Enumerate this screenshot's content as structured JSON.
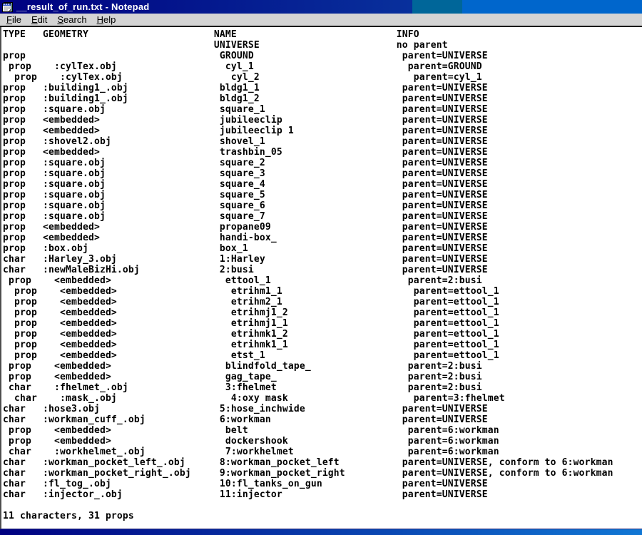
{
  "window": {
    "title": "__result_of_run.txt - Notepad"
  },
  "icons": {
    "app": "notepad-icon"
  },
  "colors": {
    "titlebar_gradient_start": "#000080",
    "titlebar_gradient_end": "#08309c",
    "desktop_gap": "#006699",
    "background_window_blue": "#0066cc",
    "menubar_gray": "#d4d4d4",
    "text": "#000000",
    "paper": "#ffffff"
  },
  "menu": {
    "items": [
      "File",
      "Edit",
      "Search",
      "Help"
    ]
  },
  "document": {
    "header": {
      "d": 0,
      "type": "TYPE",
      "geometry": "GEOMETRY",
      "name": "NAME",
      "info": "INFO"
    },
    "rows": [
      {
        "d": 0,
        "type": "",
        "geometry": "",
        "name": "UNIVERSE",
        "info": "no parent"
      },
      {
        "d": 1,
        "type": "prop",
        "geometry": "",
        "name": "GROUND",
        "info": "parent=UNIVERSE"
      },
      {
        "d": 2,
        "type": "prop",
        "geometry": ":cylTex.obj",
        "name": "cyl_1",
        "info": "parent=GROUND"
      },
      {
        "d": 3,
        "type": "prop",
        "geometry": ":cylTex.obj",
        "name": "cyl_2",
        "info": "parent=cyl_1"
      },
      {
        "d": 1,
        "type": "prop",
        "geometry": ":building1_.obj",
        "name": "bldg1_1",
        "info": "parent=UNIVERSE"
      },
      {
        "d": 1,
        "type": "prop",
        "geometry": ":building1_.obj",
        "name": "bldg1_2",
        "info": "parent=UNIVERSE"
      },
      {
        "d": 1,
        "type": "prop",
        "geometry": ":square.obj",
        "name": "square_1",
        "info": "parent=UNIVERSE"
      },
      {
        "d": 1,
        "type": "prop",
        "geometry": "<embedded>",
        "name": "jubileeclip",
        "info": "parent=UNIVERSE"
      },
      {
        "d": 1,
        "type": "prop",
        "geometry": "<embedded>",
        "name": "jubileeclip 1",
        "info": "parent=UNIVERSE"
      },
      {
        "d": 1,
        "type": "prop",
        "geometry": ":shovel2.obj",
        "name": "shovel_1",
        "info": "parent=UNIVERSE"
      },
      {
        "d": 1,
        "type": "prop",
        "geometry": "<embedded>",
        "name": "trashbin_05",
        "info": "parent=UNIVERSE"
      },
      {
        "d": 1,
        "type": "prop",
        "geometry": ":square.obj",
        "name": "square_2",
        "info": "parent=UNIVERSE"
      },
      {
        "d": 1,
        "type": "prop",
        "geometry": ":square.obj",
        "name": "square_3",
        "info": "parent=UNIVERSE"
      },
      {
        "d": 1,
        "type": "prop",
        "geometry": ":square.obj",
        "name": "square_4",
        "info": "parent=UNIVERSE"
      },
      {
        "d": 1,
        "type": "prop",
        "geometry": ":square.obj",
        "name": "square_5",
        "info": "parent=UNIVERSE"
      },
      {
        "d": 1,
        "type": "prop",
        "geometry": ":square.obj",
        "name": "square_6",
        "info": "parent=UNIVERSE"
      },
      {
        "d": 1,
        "type": "prop",
        "geometry": ":square.obj",
        "name": "square_7",
        "info": "parent=UNIVERSE"
      },
      {
        "d": 1,
        "type": "prop",
        "geometry": "<embedded>",
        "name": "propane09",
        "info": "parent=UNIVERSE"
      },
      {
        "d": 1,
        "type": "prop",
        "geometry": "<embedded>",
        "name": "handi-box_",
        "info": "parent=UNIVERSE"
      },
      {
        "d": 1,
        "type": "prop",
        "geometry": ":box.obj",
        "name": "box_1",
        "info": "parent=UNIVERSE"
      },
      {
        "d": 1,
        "type": "char",
        "geometry": ":Harley_3.obj",
        "name": "1:Harley",
        "info": "parent=UNIVERSE"
      },
      {
        "d": 1,
        "type": "char",
        "geometry": ":newMaleBizHi.obj",
        "name": "2:busi",
        "info": "parent=UNIVERSE"
      },
      {
        "d": 2,
        "type": "prop",
        "geometry": "<embedded>",
        "name": "ettool_1",
        "info": "parent=2:busi"
      },
      {
        "d": 3,
        "type": "prop",
        "geometry": "<embedded>",
        "name": "etrihm1_1",
        "info": "parent=ettool_1"
      },
      {
        "d": 3,
        "type": "prop",
        "geometry": "<embedded>",
        "name": "etrihm2_1",
        "info": "parent=ettool_1"
      },
      {
        "d": 3,
        "type": "prop",
        "geometry": "<embedded>",
        "name": "etrihmj1_2",
        "info": "parent=ettool_1"
      },
      {
        "d": 3,
        "type": "prop",
        "geometry": "<embedded>",
        "name": "etrihmj1_1",
        "info": "parent=ettool_1"
      },
      {
        "d": 3,
        "type": "prop",
        "geometry": "<embedded>",
        "name": "etrihmk1_2",
        "info": "parent=ettool_1"
      },
      {
        "d": 3,
        "type": "prop",
        "geometry": "<embedded>",
        "name": "etrihmk1_1",
        "info": "parent=ettool_1"
      },
      {
        "d": 3,
        "type": "prop",
        "geometry": "<embedded>",
        "name": "etst_1",
        "info": "parent=ettool_1"
      },
      {
        "d": 2,
        "type": "prop",
        "geometry": "<embedded>",
        "name": "blindfold_tape_",
        "info": "parent=2:busi"
      },
      {
        "d": 2,
        "type": "prop",
        "geometry": "<embedded>",
        "name": "gag_tape_",
        "info": "parent=2:busi"
      },
      {
        "d": 2,
        "type": "char",
        "geometry": ":fhelmet_.obj",
        "name": "3:fhelmet",
        "info": "parent=2:busi"
      },
      {
        "d": 3,
        "type": "char",
        "geometry": ":mask_.obj",
        "name": "4:oxy mask",
        "info": "parent=3:fhelmet"
      },
      {
        "d": 1,
        "type": "char",
        "geometry": ":hose3.obj",
        "name": "5:hose_inchwide",
        "info": "parent=UNIVERSE"
      },
      {
        "d": 1,
        "type": "char",
        "geometry": ":workman_cuff_.obj",
        "name": "6:workman",
        "info": "parent=UNIVERSE"
      },
      {
        "d": 2,
        "type": "prop",
        "geometry": "<embedded>",
        "name": "belt",
        "info": "parent=6:workman"
      },
      {
        "d": 2,
        "type": "prop",
        "geometry": "<embedded>",
        "name": "dockershook",
        "info": "parent=6:workman"
      },
      {
        "d": 2,
        "type": "char",
        "geometry": ":workhelmet_.obj",
        "name": "7:workhelmet",
        "info": "parent=6:workman"
      },
      {
        "d": 1,
        "type": "char",
        "geometry": ":workman_pocket_left_.obj",
        "name": "8:workman_pocket_left",
        "info": "parent=UNIVERSE, conform to 6:workman"
      },
      {
        "d": 1,
        "type": "char",
        "geometry": ":workman_pocket_right_.obj",
        "name": "9:workman_pocket_right",
        "info": "parent=UNIVERSE, conform to 6:workman"
      },
      {
        "d": 1,
        "type": "char",
        "geometry": ":fl_tog_.obj",
        "name": "10:fl_tanks_on_gun",
        "info": "parent=UNIVERSE"
      },
      {
        "d": 1,
        "type": "char",
        "geometry": ":injector_.obj",
        "name": "11:injector",
        "info": "parent=UNIVERSE"
      }
    ],
    "footer": "11 characters, 31 props"
  }
}
